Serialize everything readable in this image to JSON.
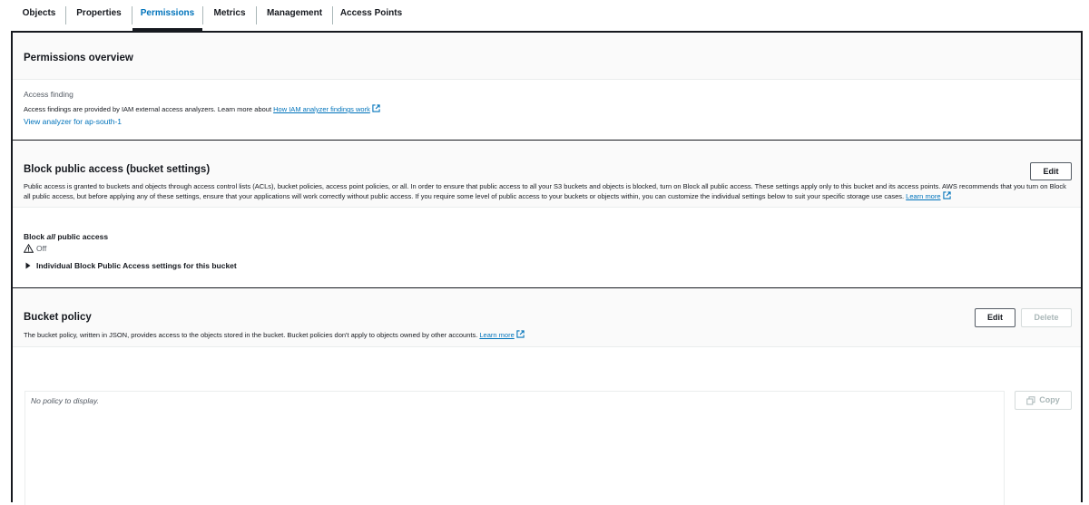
{
  "tabs": [
    {
      "label": "Objects"
    },
    {
      "label": "Properties"
    },
    {
      "label": "Permissions"
    },
    {
      "label": "Metrics"
    },
    {
      "label": "Management"
    },
    {
      "label": "Access Points"
    }
  ],
  "permissions_overview": {
    "title": "Permissions overview",
    "access_finding_label": "Access finding",
    "access_finding_desc": "Access findings are provided by IAM external access analyzers. Learn more about ",
    "access_finding_link": "How IAM analyzer findings work",
    "view_analyzer_link": "View analyzer for ap-south-1"
  },
  "block_public_access": {
    "title": "Block public access (bucket settings)",
    "edit_label": "Edit",
    "description": "Public access is granted to buckets and objects through access control lists (ACLs), bucket policies, access point policies, or all. In order to ensure that public access to all your S3 buckets and objects is blocked, turn on Block all public access. These settings apply only to this bucket and its access points. AWS recommends that you turn on Block all public access, but before applying any of these settings, ensure that your applications will work correctly without public access. If you require some level of public access to your buckets or objects within, you can customize the individual settings below to suit your specific storage use cases.",
    "learn_more": "Learn more",
    "setting_label_pre": "Block ",
    "setting_label_em": "all",
    "setting_label_post": " public access",
    "status": "Off",
    "expand_label": "Individual Block Public Access settings for this bucket"
  },
  "bucket_policy": {
    "title": "Bucket policy",
    "edit_label": "Edit",
    "delete_label": "Delete",
    "description": "The bucket policy, written in JSON, provides access to the objects stored in the bucket. Bucket policies don't apply to objects owned by other accounts. ",
    "learn_more": "Learn more",
    "empty_text": "No policy to display.",
    "copy_label": "Copy"
  },
  "colors": {
    "link": "#0073bb",
    "text": "#16191f",
    "warning": "#d4a017"
  }
}
